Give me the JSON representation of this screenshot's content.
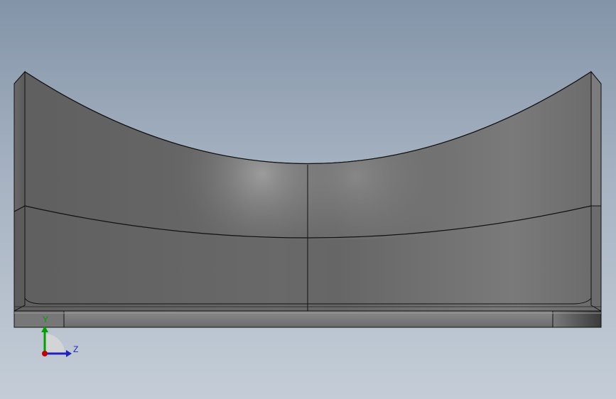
{
  "viewport": {
    "background_top": "#8394a8",
    "background_bottom": "#c4cdd7",
    "model_color": "#6e6e6e",
    "edge_color": "#111111"
  },
  "triad": {
    "y_label": "Y",
    "z_label": "Z",
    "y_color": "#00a000",
    "z_color": "#2020c0",
    "x_color": "#c00000"
  }
}
